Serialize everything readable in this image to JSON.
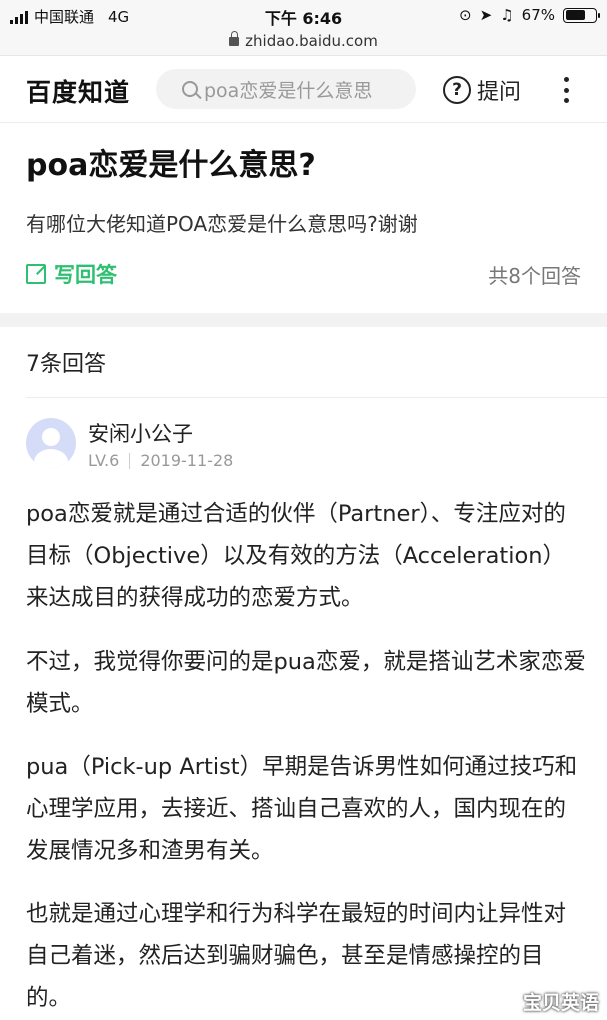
{
  "status_bar": {
    "carrier": "中国联通",
    "network": "4G",
    "time": "下午 6:46",
    "battery": "67%",
    "battery_level": 0.67
  },
  "url_bar": {
    "url": "zhidao.baidu.com"
  },
  "header": {
    "logo": "百度知道",
    "search_placeholder": "poa恋爱是什么意思",
    "ask_label": "提问",
    "ask_icon": "question-circle-icon"
  },
  "question": {
    "title": "poa恋爱是什么意思?",
    "description": "有哪位大佬知道POA恋爱是什么意思吗?谢谢",
    "write_answer": "写回答",
    "total_answers": "共8个回答"
  },
  "answers_section": {
    "count_label": "7条回答"
  },
  "answer": {
    "user_name": "安闲小公子",
    "level": "LV.6",
    "date": "2019-11-28",
    "paragraphs": [
      "poa恋爱就是通过合适的伙伴（Partner）、专注应对的目标（Objective）以及有效的方法（Acceleration）来达成目的获得成功的恋爱方式。",
      "不过，我觉得你要问的是pua恋爱，就是搭讪艺术家恋爱模式。",
      "pua（Pick-up Artist）早期是告诉男性如何通过技巧和心理学应用，去接近、搭讪自己喜欢的人，国内现在的发展情况多和渣男有关。",
      "也就是通过心理学和行为科学在最短的时间内让异性对自己着迷，然后达到骗财骗色，甚至是情感操控的目的。"
    ]
  },
  "watermark": "宝贝英语",
  "colors": {
    "accent_green": "#2fbf71",
    "muted_gray": "#999999"
  }
}
